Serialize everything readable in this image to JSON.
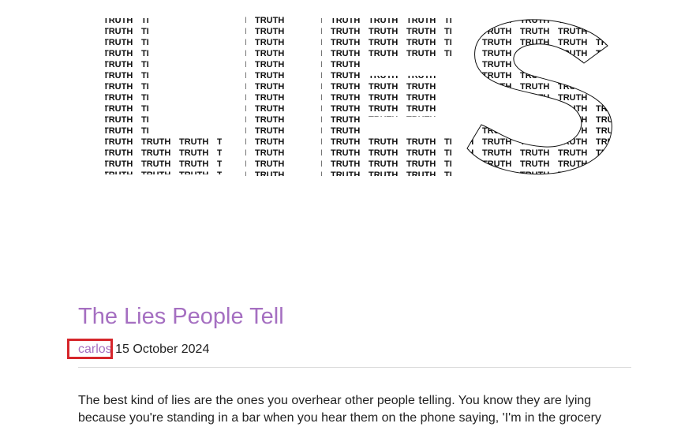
{
  "hero": {
    "image_name": "lies-truth-word-art",
    "letters": [
      "L",
      "I",
      "E",
      "S"
    ],
    "fill_word": "TRUTH"
  },
  "post": {
    "title": "The Lies People Tell",
    "author": "carlos",
    "separator": " ",
    "date": "15 October 2024",
    "body_line_1": "The best kind of lies are the ones you overhear other people telling. You know they are lying",
    "body_line_2": "because you're standing in a bar when you hear them on the phone saying, 'I'm in the grocery"
  },
  "colors": {
    "accent": "#a56fc1",
    "text": "#222222",
    "highlight": "#d6262b"
  }
}
